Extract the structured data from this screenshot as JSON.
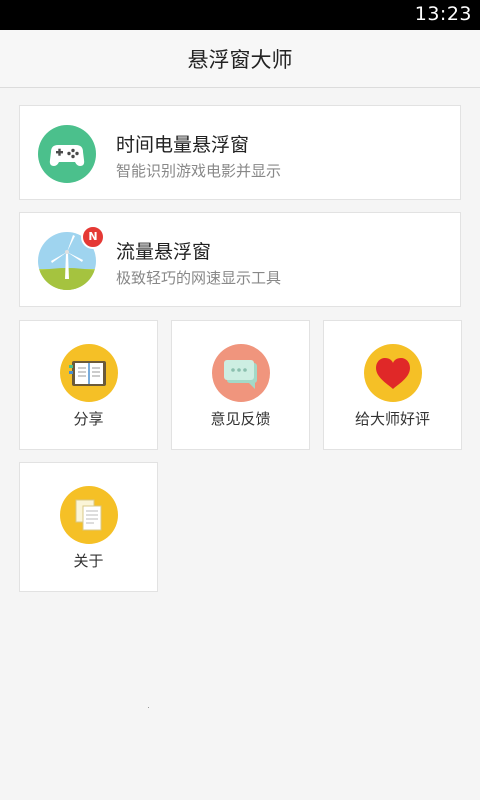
{
  "status_bar": {
    "time": "13:23"
  },
  "header": {
    "title": "悬浮窗大师"
  },
  "features": [
    {
      "name": "时间电量悬浮窗",
      "description": "智能识别游戏电影并显示",
      "icon": "gamepad-icon",
      "color": "#4bc08c"
    },
    {
      "name": "流量悬浮窗",
      "description": "极致轻巧的网速显示工具",
      "icon": "windmill-icon",
      "badge": "N"
    }
  ],
  "tiles": [
    {
      "label": "分享",
      "icon": "notebook-icon",
      "color": "#f5c026"
    },
    {
      "label": "意见反馈",
      "icon": "chat-bubble-icon",
      "color": "#f0957d"
    },
    {
      "label": "给大师好评",
      "icon": "heart-icon",
      "color": "#f5c026"
    },
    {
      "label": "关于",
      "icon": "documents-icon",
      "color": "#f5c026"
    }
  ]
}
